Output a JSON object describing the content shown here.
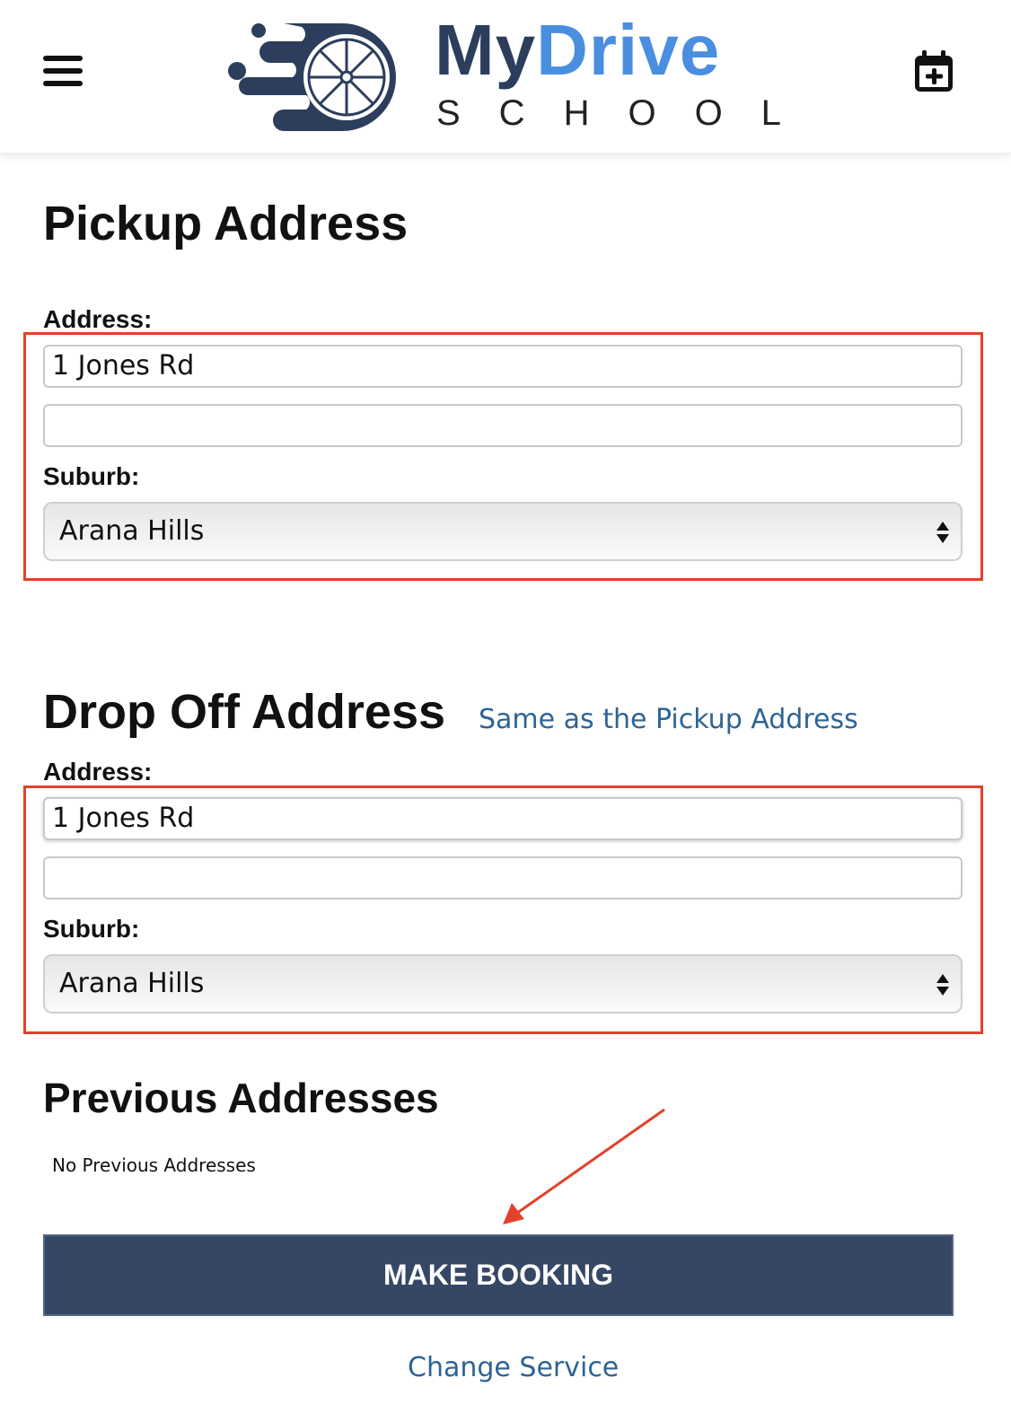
{
  "header": {
    "logo_primary": "My",
    "logo_accent": "Drive",
    "logo_secondary": "SCHOOL",
    "menu_icon": "hamburger-menu-icon",
    "calendar_icon": "calendar-add-icon"
  },
  "pickup": {
    "title": "Pickup Address",
    "address_label": "Address:",
    "address_line1": "1 Jones Rd",
    "address_line2": "",
    "suburb_label": "Suburb:",
    "suburb_value": "Arana Hills"
  },
  "dropoff": {
    "title": "Drop Off Address",
    "same_as_link": "Same as the Pickup Address",
    "address_label": "Address:",
    "address_line1": "1 Jones Rd",
    "address_line2": "",
    "suburb_label": "Suburb:",
    "suburb_value": "Arana Hills"
  },
  "previous": {
    "title": "Previous Addresses",
    "empty_text": "No Previous Addresses"
  },
  "actions": {
    "make_booking": "MAKE BOOKING",
    "change_service": "Change Service"
  },
  "colors": {
    "brand_dark": "#2c3e5c",
    "brand_accent": "#4a8ee0",
    "button": "#364766",
    "link": "#2e6496",
    "annotation": "#e2412b"
  }
}
